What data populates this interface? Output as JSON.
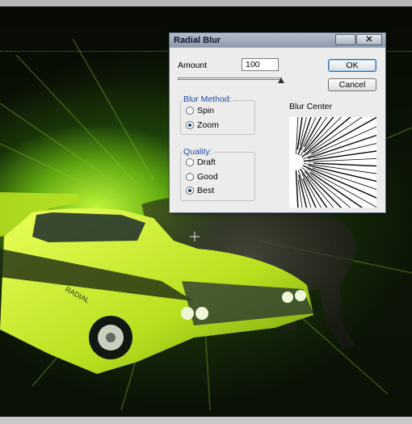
{
  "dialog": {
    "title": "Radial Blur",
    "close_glyph": "✕",
    "amount_label": "Amount",
    "amount_value": "100",
    "ok_label": "OK",
    "cancel_label": "Cancel",
    "blur_method": {
      "legend": "Blur Method:",
      "options": [
        {
          "label": "Spin",
          "selected": false
        },
        {
          "label": "Zoom",
          "selected": true
        }
      ]
    },
    "quality": {
      "legend": "Quality:",
      "options": [
        {
          "label": "Draft",
          "selected": false
        },
        {
          "label": "Good",
          "selected": false
        },
        {
          "label": "Best",
          "selected": true
        }
      ]
    },
    "blur_center_label": "Blur Center"
  },
  "canvas": {
    "image_text": "RADIAL",
    "colors": {
      "glow": "#c8ff3c",
      "dark": "#070a04",
      "car_body": "#d8f23c"
    }
  }
}
